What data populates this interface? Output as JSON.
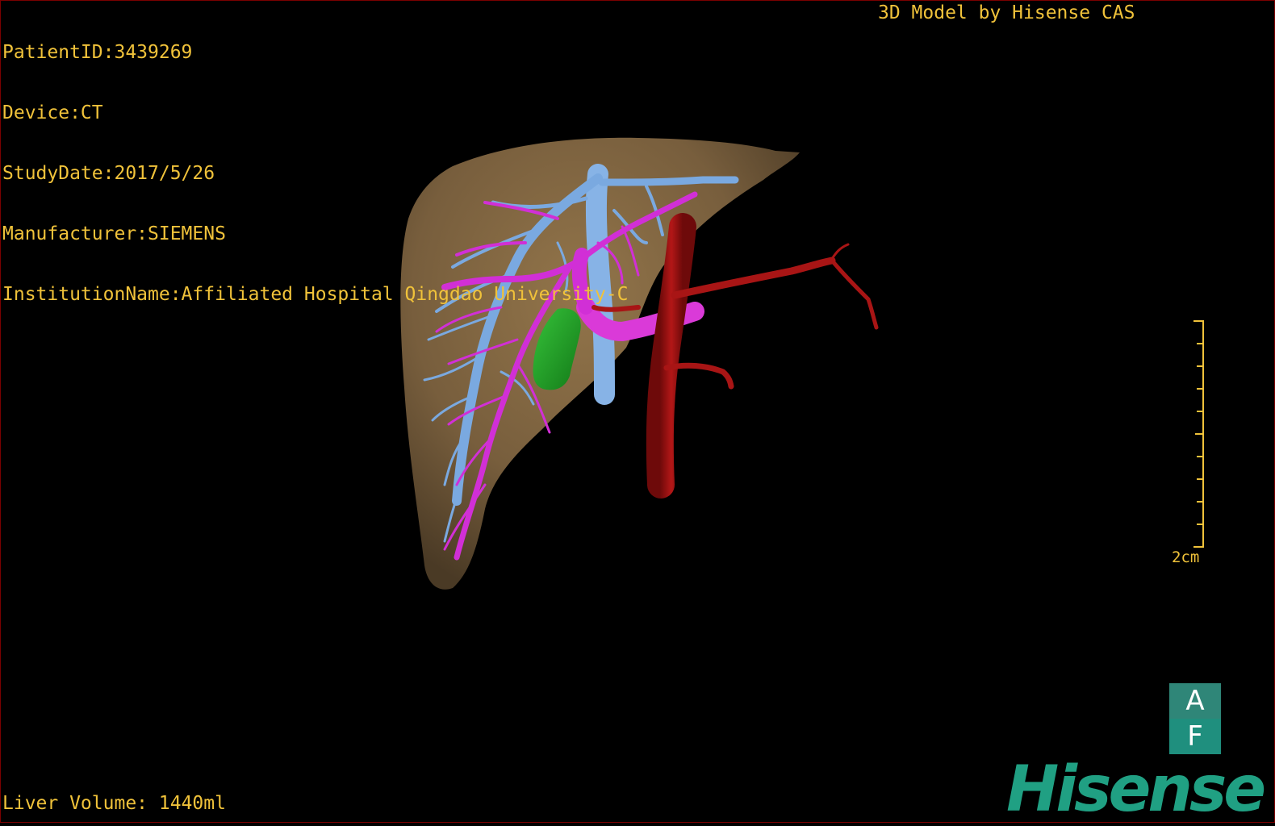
{
  "header": {
    "patient_id": "PatientID:3439269",
    "device": "Device:CT",
    "study_date": "StudyDate:2017/5/26",
    "manufacturer": "Manufacturer:SIEMENS",
    "institution": "InstitutionName:Affiliated Hospital Qingdao University-C"
  },
  "credit": "3D Model by Hisense CAS",
  "footer": {
    "liver_volume": "Liver Volume: 1440ml"
  },
  "scale": {
    "label": "2cm"
  },
  "orientation_cube": {
    "top_label": "A",
    "front_label": "F"
  },
  "brand": {
    "name": "Hisense",
    "color": "#20a083"
  },
  "colors": {
    "overlay_text": "#f0c23a",
    "liver": "#8a6d44",
    "portal_vein": "#d12fd6",
    "hepatic_vein": "#7aa9e0",
    "artery": "#a11212",
    "gallbladder": "#1f9a24"
  }
}
